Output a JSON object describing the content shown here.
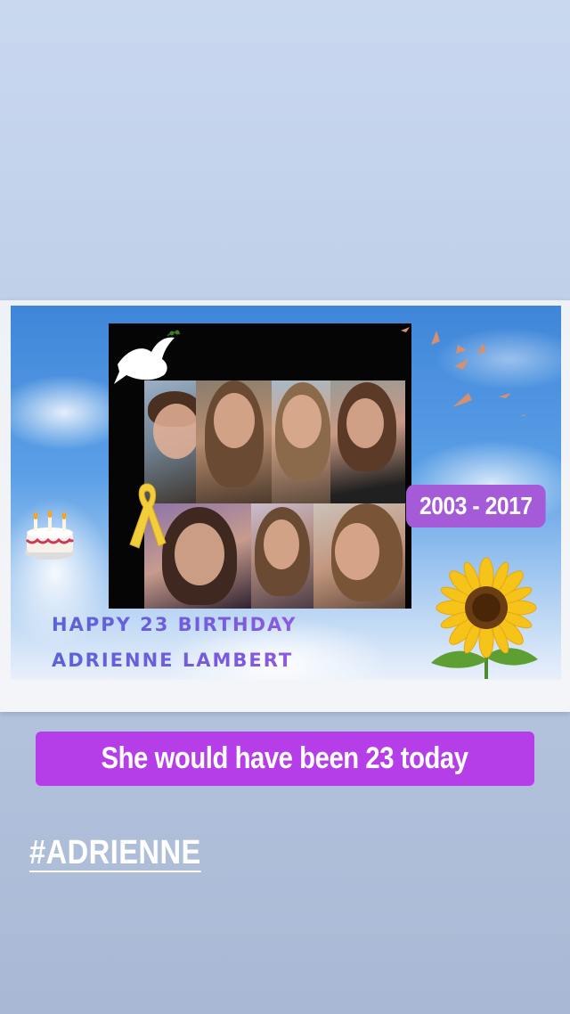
{
  "post": {
    "dates_badge": "2003 - 2017",
    "birthday_line1": "HAPPY 23 BIRTHDAY",
    "birthday_line2": "ADRIENNE LAMBERT",
    "caption": "She would have been 23 today",
    "hashtag": "#ADRIENNE"
  },
  "stickers": [
    "dove-icon",
    "yellow-ribbon-icon",
    "birthday-cake-icon",
    "sunflower-icon",
    "birds-icon"
  ],
  "colors": {
    "badge": "#a55bd8",
    "caption_bg": "#b63ee8",
    "text_gradient_start": "#5a63d6",
    "text_gradient_end": "#c55ed6"
  }
}
